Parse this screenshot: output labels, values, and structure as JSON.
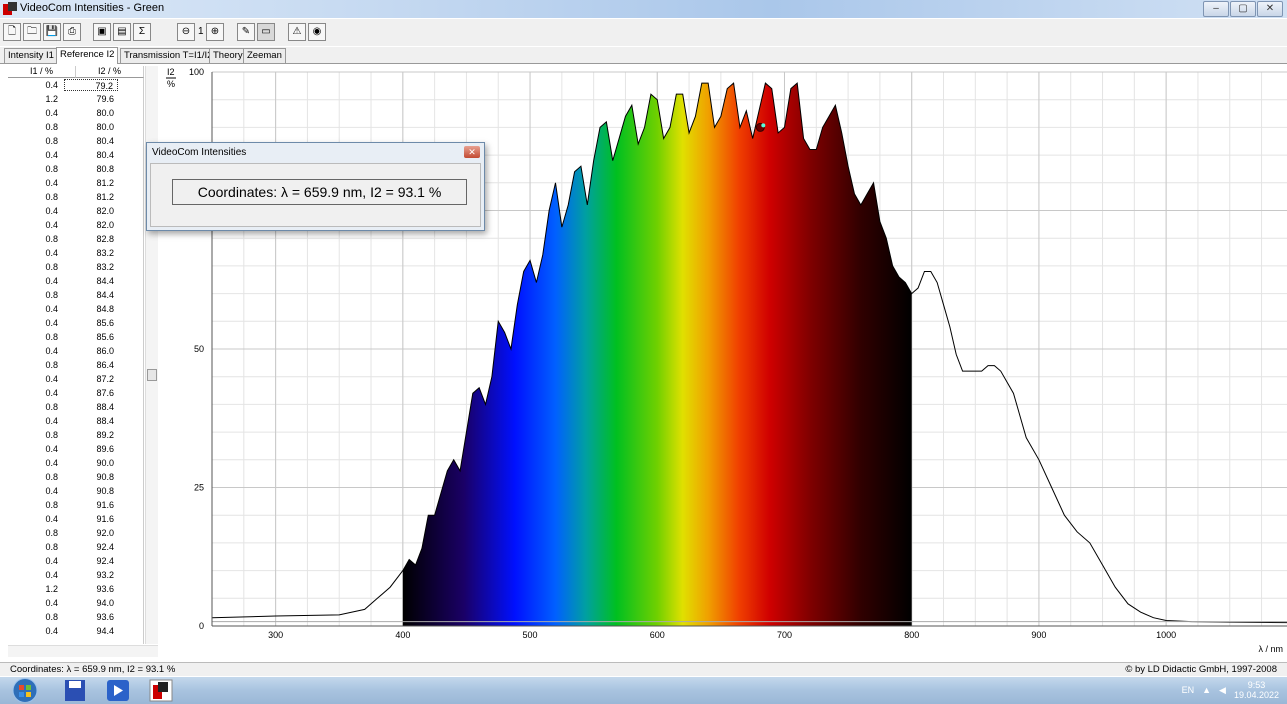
{
  "window": {
    "title": "VideoCom Intensities - Green",
    "controls": [
      "–",
      "▢",
      "✕"
    ]
  },
  "toolbar": {
    "zoom_level": "1"
  },
  "tabs": [
    {
      "label": "Intensity I1",
      "active": false
    },
    {
      "label": "Reference I2",
      "active": true
    },
    {
      "label": "Transmission T=I1/I2",
      "active": false
    },
    {
      "label": "Theory",
      "active": false
    },
    {
      "label": "Zeeman",
      "active": false
    }
  ],
  "table": {
    "headers": [
      "I1 / %",
      "I2 / %"
    ],
    "rows": [
      [
        "0.4",
        "79.2"
      ],
      [
        "1.2",
        "79.6"
      ],
      [
        "0.4",
        "80.0"
      ],
      [
        "0.8",
        "80.0"
      ],
      [
        "0.8",
        "80.4"
      ],
      [
        "0.4",
        "80.4"
      ],
      [
        "0.8",
        "80.8"
      ],
      [
        "0.4",
        "81.2"
      ],
      [
        "0.8",
        "81.2"
      ],
      [
        "0.4",
        "82.0"
      ],
      [
        "0.4",
        "82.0"
      ],
      [
        "0.8",
        "82.8"
      ],
      [
        "0.4",
        "83.2"
      ],
      [
        "0.8",
        "83.2"
      ],
      [
        "0.4",
        "84.4"
      ],
      [
        "0.8",
        "84.4"
      ],
      [
        "0.4",
        "84.8"
      ],
      [
        "0.4",
        "85.6"
      ],
      [
        "0.8",
        "85.6"
      ],
      [
        "0.4",
        "86.0"
      ],
      [
        "0.8",
        "86.4"
      ],
      [
        "0.4",
        "87.2"
      ],
      [
        "0.4",
        "87.6"
      ],
      [
        "0.8",
        "88.4"
      ],
      [
        "0.4",
        "88.4"
      ],
      [
        "0.8",
        "89.2"
      ],
      [
        "0.4",
        "89.6"
      ],
      [
        "0.4",
        "90.0"
      ],
      [
        "0.8",
        "90.8"
      ],
      [
        "0.4",
        "90.8"
      ],
      [
        "0.8",
        "91.6"
      ],
      [
        "0.4",
        "91.6"
      ],
      [
        "0.8",
        "92.0"
      ],
      [
        "0.8",
        "92.4"
      ],
      [
        "0.4",
        "92.4"
      ],
      [
        "0.4",
        "93.2"
      ],
      [
        "1.2",
        "93.6"
      ],
      [
        "0.4",
        "94.0"
      ],
      [
        "0.8",
        "93.6"
      ],
      [
        "0.4",
        "94.4"
      ]
    ]
  },
  "chart_data": {
    "type": "line",
    "ylabel": "I2",
    "yunit": "%",
    "xlabel": "λ / nm",
    "xlim": [
      250,
      1095
    ],
    "ylim": [
      0,
      100
    ],
    "xticks": [
      300,
      400,
      500,
      600,
      700,
      800,
      900,
      1000
    ],
    "yticks": [
      0,
      25,
      50,
      100
    ],
    "grid": true,
    "filled_range_nm": [
      400,
      800
    ],
    "x": [
      250,
      300,
      350,
      370,
      380,
      390,
      400,
      405,
      410,
      415,
      420,
      425,
      430,
      435,
      440,
      445,
      450,
      455,
      460,
      465,
      470,
      475,
      480,
      485,
      490,
      495,
      500,
      505,
      510,
      515,
      520,
      525,
      530,
      535,
      540,
      545,
      550,
      555,
      560,
      565,
      570,
      575,
      580,
      585,
      590,
      595,
      600,
      605,
      610,
      615,
      620,
      625,
      630,
      635,
      640,
      645,
      650,
      655,
      660,
      665,
      670,
      675,
      680,
      685,
      690,
      695,
      700,
      705,
      710,
      715,
      720,
      725,
      730,
      735,
      740,
      745,
      750,
      755,
      760,
      765,
      770,
      775,
      780,
      785,
      790,
      795,
      800,
      805,
      810,
      815,
      820,
      825,
      830,
      835,
      840,
      845,
      850,
      855,
      860,
      865,
      870,
      875,
      880,
      885,
      890,
      900,
      910,
      920,
      930,
      940,
      950,
      960,
      970,
      980,
      990,
      1000,
      1020,
      1050,
      1095
    ],
    "y": [
      1.5,
      1.8,
      2,
      3,
      5,
      7,
      10,
      12,
      11,
      14,
      20,
      20,
      24,
      28,
      30,
      28,
      35,
      42,
      43,
      40,
      45,
      55,
      53,
      50,
      58,
      64,
      66,
      62,
      67,
      75,
      80,
      72,
      76,
      82,
      83,
      76,
      84,
      90,
      91,
      84,
      88,
      92,
      94,
      87,
      90,
      96,
      95,
      88,
      90,
      96,
      96,
      89,
      92,
      98,
      98,
      90,
      92,
      97,
      98,
      90,
      93,
      88,
      93,
      98,
      97,
      89,
      90,
      97,
      98,
      88,
      86,
      86,
      90,
      92,
      94,
      89,
      83,
      78,
      76,
      78,
      80,
      73,
      70,
      65,
      63,
      62,
      60,
      61,
      64,
      64,
      62,
      58,
      54,
      49,
      46,
      46,
      46,
      46,
      47,
      47,
      46,
      44,
      42,
      38,
      34,
      30,
      25,
      20,
      17,
      15,
      11,
      7,
      4,
      2.5,
      1.5,
      1,
      0.8,
      0.7,
      0.6
    ]
  },
  "dialog": {
    "title": "VideoCom Intensities",
    "coords_text": "Coordinates:  λ =  659.9 nm,   I2 =  93.1 %"
  },
  "status": {
    "left": "Coordinates:  λ = 659.9 nm,  I2 = 93.1 %",
    "right": "© by LD Didactic GmbH, 1997-2008"
  },
  "tray": {
    "lang": "EN",
    "time": "9:53",
    "date": "19.04.2022"
  }
}
